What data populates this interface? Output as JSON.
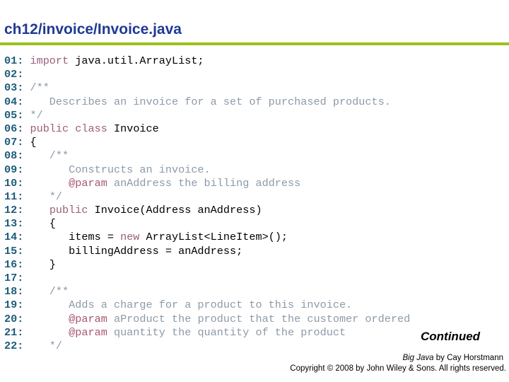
{
  "header": {
    "title": "ch12/invoice/Invoice.java",
    "accent_color": "#99c21b",
    "title_color": "#1f3a93"
  },
  "code": {
    "colors": {
      "line_number": "#1e5b7a",
      "keyword": "#9a5f7a",
      "comment": "#8c9aa8",
      "text": "#000000"
    },
    "lines": [
      {
        "num": "01:",
        "segments": [
          {
            "t": "kw",
            "s": "import"
          },
          {
            "t": "tx",
            "s": " java.util.ArrayList;"
          }
        ]
      },
      {
        "num": "02:",
        "segments": []
      },
      {
        "num": "03:",
        "segments": [
          {
            "t": "cm",
            "s": "/**"
          }
        ]
      },
      {
        "num": "04:",
        "segments": [
          {
            "t": "cm",
            "s": "   Describes an invoice for a set of purchased products."
          }
        ]
      },
      {
        "num": "05:",
        "segments": [
          {
            "t": "cm",
            "s": "*/"
          }
        ]
      },
      {
        "num": "06:",
        "segments": [
          {
            "t": "kw",
            "s": "public"
          },
          {
            "t": "tx",
            "s": " "
          },
          {
            "t": "kw",
            "s": "class"
          },
          {
            "t": "tx",
            "s": " Invoice"
          }
        ]
      },
      {
        "num": "07:",
        "segments": [
          {
            "t": "tx",
            "s": "{"
          }
        ]
      },
      {
        "num": "08:",
        "segments": [
          {
            "t": "cm",
            "s": "   /**"
          }
        ]
      },
      {
        "num": "09:",
        "segments": [
          {
            "t": "cm",
            "s": "      Constructs an invoice."
          }
        ]
      },
      {
        "num": "10:",
        "segments": [
          {
            "t": "cm",
            "s": "      "
          },
          {
            "t": "tag",
            "s": "@param"
          },
          {
            "t": "cm",
            "s": " anAddress the billing address"
          }
        ]
      },
      {
        "num": "11:",
        "segments": [
          {
            "t": "cm",
            "s": "   */"
          }
        ]
      },
      {
        "num": "12:",
        "segments": [
          {
            "t": "tx",
            "s": "   "
          },
          {
            "t": "kw",
            "s": "public"
          },
          {
            "t": "tx",
            "s": " Invoice(Address anAddress)"
          }
        ]
      },
      {
        "num": "13:",
        "segments": [
          {
            "t": "tx",
            "s": "   {"
          }
        ]
      },
      {
        "num": "14:",
        "segments": [
          {
            "t": "tx",
            "s": "      items = "
          },
          {
            "t": "kw",
            "s": "new"
          },
          {
            "t": "tx",
            "s": " ArrayList<LineItem>();"
          }
        ]
      },
      {
        "num": "15:",
        "segments": [
          {
            "t": "tx",
            "s": "      billingAddress = anAddress;"
          }
        ]
      },
      {
        "num": "16:",
        "segments": [
          {
            "t": "tx",
            "s": "   }"
          }
        ]
      },
      {
        "num": "17:",
        "segments": []
      },
      {
        "num": "18:",
        "segments": [
          {
            "t": "cm",
            "s": "   /**"
          }
        ]
      },
      {
        "num": "19:",
        "segments": [
          {
            "t": "cm",
            "s": "      Adds a charge for a product to this invoice."
          }
        ]
      },
      {
        "num": "20:",
        "segments": [
          {
            "t": "cm",
            "s": "      "
          },
          {
            "t": "tag",
            "s": "@param"
          },
          {
            "t": "cm",
            "s": " aProduct the product that the customer ordered"
          }
        ]
      },
      {
        "num": "21:",
        "segments": [
          {
            "t": "cm",
            "s": "      "
          },
          {
            "t": "tag",
            "s": "@param"
          },
          {
            "t": "cm",
            "s": " quantity the quantity of the product"
          }
        ]
      },
      {
        "num": "22:",
        "segments": [
          {
            "t": "cm",
            "s": "   */"
          }
        ]
      }
    ]
  },
  "footer": {
    "continued": "Continued",
    "book_title": "Big Java",
    "book_author": " by Cay Horstmann",
    "copyright": "Copyright © 2008 by John Wiley & Sons.  All rights reserved."
  }
}
